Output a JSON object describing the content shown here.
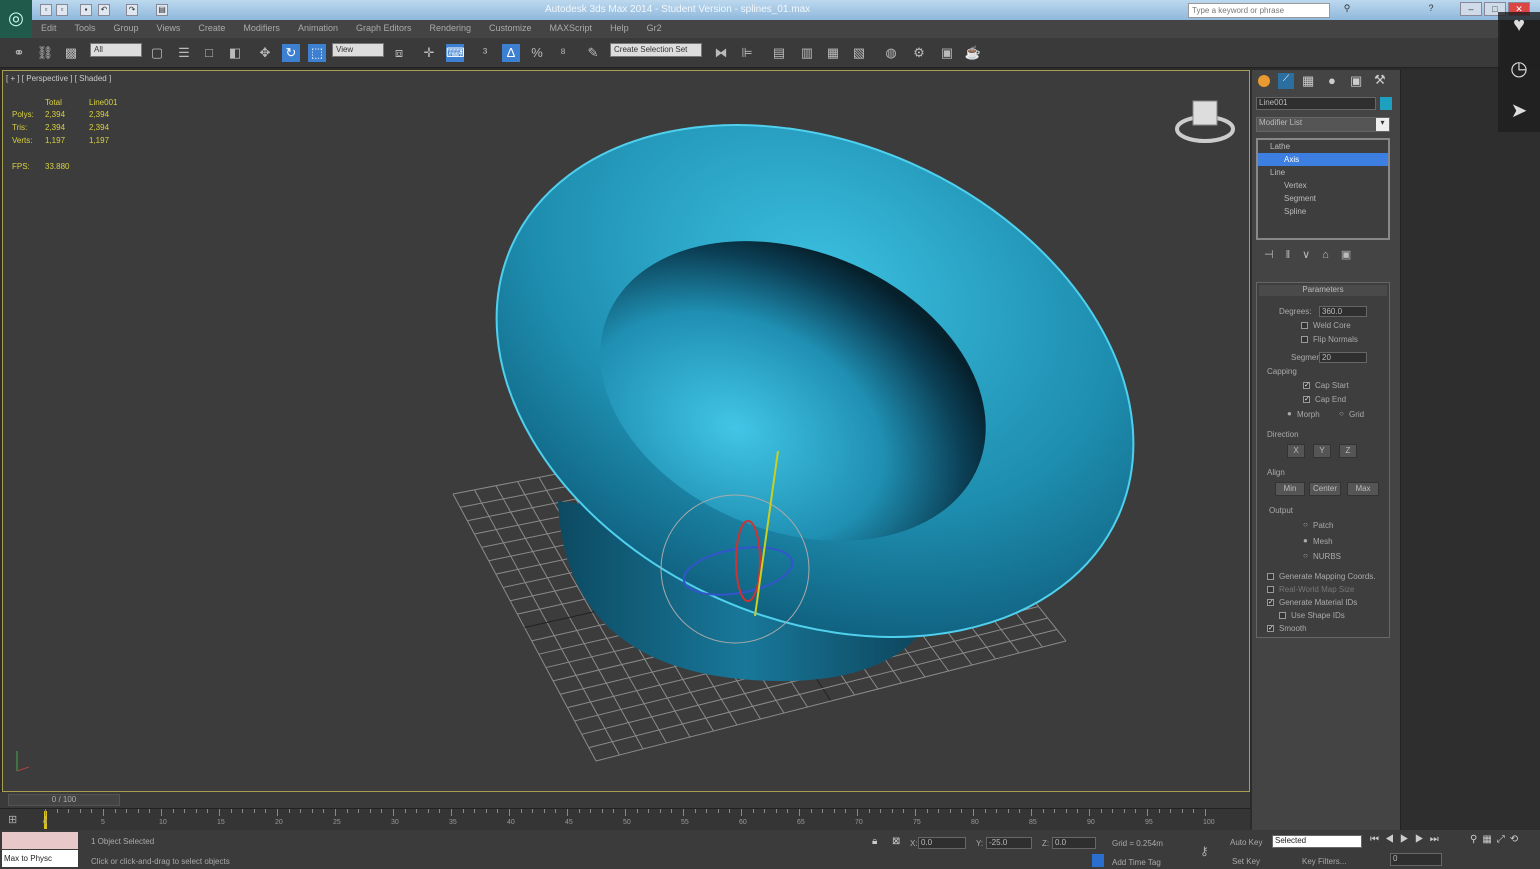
{
  "app": {
    "title": "Autodesk 3ds Max 2014 - Student Version - splines_01.max",
    "search_placeholder": "Type a keyword or phrase"
  },
  "menu": [
    "Edit",
    "Tools",
    "Group",
    "Views",
    "Create",
    "Modifiers",
    "Animation",
    "Graph Editors",
    "Rendering",
    "Customize",
    "MAXScript",
    "Help",
    "Gr2"
  ],
  "toolbar": {
    "selection_filter": "All",
    "ref_coord": "View",
    "named_selection": "Create Selection Set"
  },
  "viewport": {
    "label": "[ + ] [ Perspective ] [ Shaded ]",
    "stats": {
      "headers": [
        "Total",
        "Line001"
      ],
      "rows": [
        [
          "Polys:",
          "2,394",
          "2,394"
        ],
        [
          "Tris:",
          "2,394",
          "2,394"
        ],
        [
          "Verts:",
          "1,197",
          "1,197"
        ]
      ],
      "fps_label": "FPS:",
      "fps": "33.880"
    },
    "object_color": "#2aa8c8"
  },
  "command_panel": {
    "object_name": "Line001",
    "object_color": "#1ea0c0",
    "modifier_list": "Modifier List",
    "stack": [
      {
        "label": "Lathe",
        "level": 0
      },
      {
        "label": "Axis",
        "level": 1,
        "selected": true
      },
      {
        "label": "Line",
        "level": 0
      },
      {
        "label": "Vertex",
        "level": 1
      },
      {
        "label": "Segment",
        "level": 1
      },
      {
        "label": "Spline",
        "level": 1
      }
    ],
    "params": {
      "title": "Parameters",
      "degrees_label": "Degrees:",
      "degrees": "360.0",
      "weld_core": "Weld Core",
      "flip_normals": "Flip Normals",
      "segments_label": "Segments:",
      "segments": "20",
      "capping": "Capping",
      "cap_start": "Cap Start",
      "cap_end": "Cap End",
      "morph": "Morph",
      "grid": "Grid",
      "direction": "Direction",
      "x": "X",
      "y": "Y",
      "z": "Z",
      "align": "Align",
      "min": "Min",
      "center": "Center",
      "max": "Max",
      "output": "Output",
      "patch": "Patch",
      "mesh": "Mesh",
      "nurbs": "NURBS",
      "gen_mapping": "Generate Mapping Coords.",
      "real_world": "Real-World Map Size",
      "gen_material": "Generate Material IDs",
      "use_shape": "Use Shape IDs",
      "smooth": "Smooth"
    }
  },
  "timeline": {
    "frame": "0 / 100",
    "ticks": [
      "0",
      "5",
      "10",
      "15",
      "20",
      "25",
      "30",
      "35",
      "40",
      "45",
      "50",
      "55",
      "60",
      "65",
      "70",
      "75",
      "80",
      "85",
      "90",
      "95",
      "100"
    ]
  },
  "status": {
    "maxscript": "Max to Physc",
    "selected": "1 Object Selected",
    "prompt": "Click or click-and-drag to select objects",
    "x_label": "X:",
    "x": "0.0",
    "y_label": "Y:",
    "y": "-25.0",
    "z_label": "Z:",
    "z": "0.0",
    "grid": "Grid = 0.254m",
    "add_time_tag": "Add Time Tag",
    "auto_key": "Auto Key",
    "set_key": "Set Key",
    "key_mode": "Selected",
    "key_filters": "Key Filters...",
    "frame_field": "0"
  }
}
